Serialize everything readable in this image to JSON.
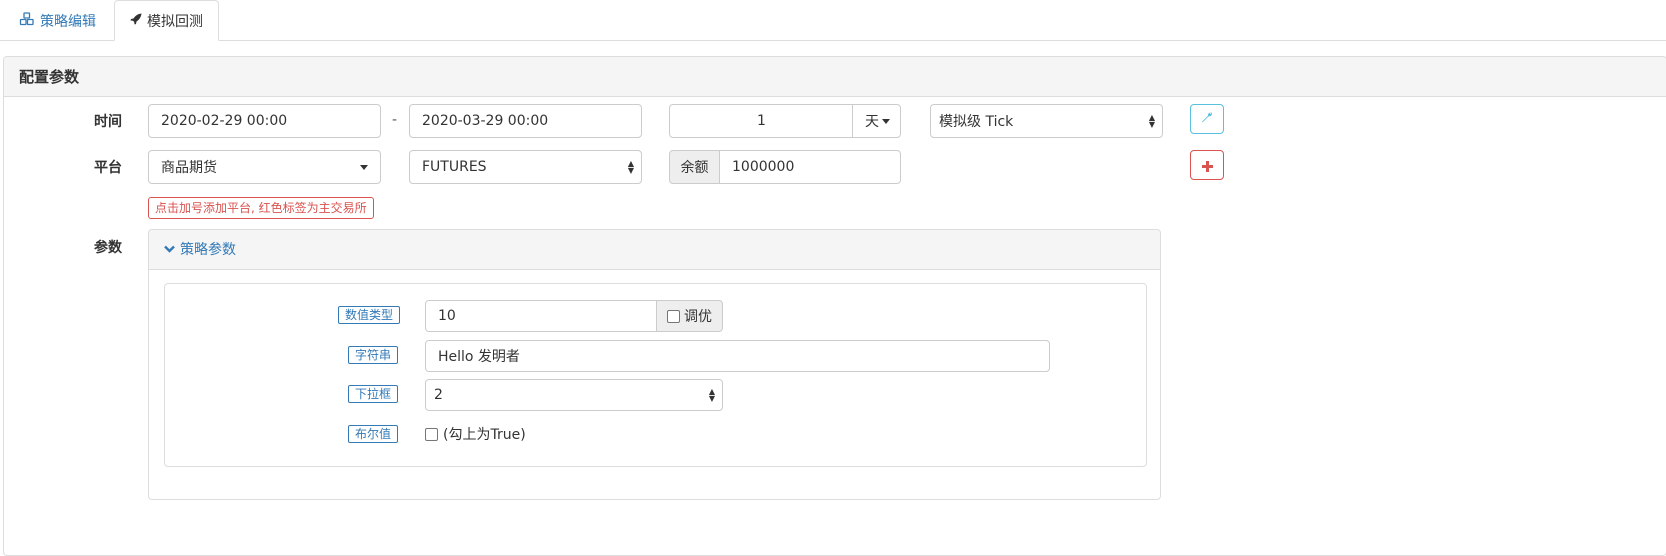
{
  "tabs": [
    {
      "label": "策略编辑",
      "icon": "cubes-icon",
      "active": false
    },
    {
      "label": "模拟回测",
      "icon": "rocket-icon",
      "active": true
    }
  ],
  "panel": {
    "title": "配置参数"
  },
  "time_row": {
    "label": "时间",
    "start": "2020-02-29 00:00",
    "separator": "-",
    "end": "2020-03-29 00:00",
    "period_value": "1",
    "period_unit": "天",
    "mode": "模拟级 Tick"
  },
  "platform_row": {
    "label": "平台",
    "exchange": "商品期货",
    "symbol": "FUTURES",
    "balance_label": "余额",
    "balance_value": "1000000",
    "hint": "点击加号添加平台, 红色标签为主交易所"
  },
  "params_row": {
    "label": "参数",
    "section_title": "策略参数",
    "params": [
      {
        "tag": "数值类型",
        "value": "10",
        "tune_label": "调优"
      },
      {
        "tag": "字符串",
        "value": "Hello 发明者"
      },
      {
        "tag": "下拉框",
        "value": "2"
      },
      {
        "tag": "布尔值",
        "checkbox_label": "(勾上为True)"
      }
    ]
  },
  "colors": {
    "link": "#337ab7",
    "danger": "#d9534f",
    "info": "#5bc0de",
    "border": "#dddddd",
    "heading_bg": "#f5f5f5"
  }
}
